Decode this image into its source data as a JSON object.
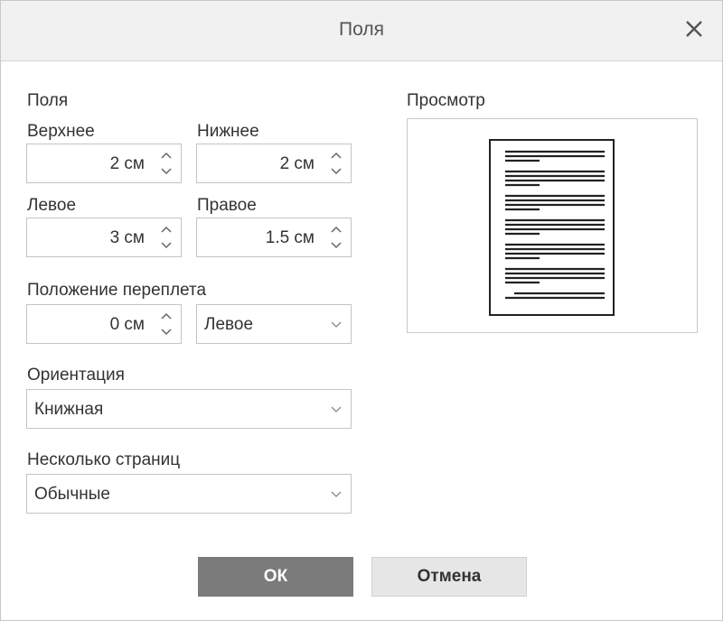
{
  "dialog": {
    "title": "Поля",
    "close_icon": "close-icon"
  },
  "margins": {
    "section_label": "Поля",
    "top_label": "Верхнее",
    "top_value": "2 см",
    "bottom_label": "Нижнее",
    "bottom_value": "2 см",
    "left_label": "Левое",
    "left_value": "3 см",
    "right_label": "Правое",
    "right_value": "1.5 см"
  },
  "gutter": {
    "label": "Положение переплета",
    "value": "0 см",
    "position_value": "Левое"
  },
  "orientation": {
    "label": "Ориентация",
    "value": "Книжная"
  },
  "multiple_pages": {
    "label": "Несколько страниц",
    "value": "Обычные"
  },
  "preview": {
    "label": "Просмотр"
  },
  "buttons": {
    "ok_label": "ОК",
    "cancel_label": "Отмена"
  }
}
